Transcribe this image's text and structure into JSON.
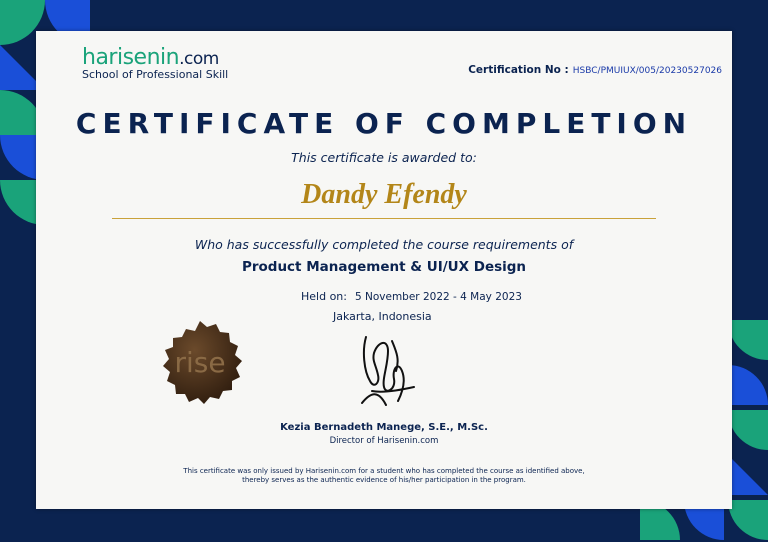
{
  "logo": {
    "name": "harisenin",
    "suffix": ".com",
    "tagline": "School of Professional Skill"
  },
  "certification": {
    "label": "Certification No :",
    "number": "HSBC/PMUIUX/005/20230527026"
  },
  "title": "CERTIFICATE OF COMPLETION",
  "awarded_text": "This certificate is awarded to:",
  "recipient": "Dandy Efendy",
  "completion_text": "Who has successfully completed the course requirements of",
  "course": "Product Management & UI/UX Design",
  "held": {
    "label": "Held on:",
    "dates": "5 November 2022 - 4 May 2023"
  },
  "location": "Jakarta, Indonesia",
  "seal": {
    "text": "rise"
  },
  "signer": {
    "name": "Kezia Bernadeth Manege, S.E., M.Sc.",
    "role": "Director of Harisenin.com"
  },
  "footnote": [
    "This certificate was only issued by Harisenin.com for a student who has completed the course as identified above,",
    "thereby serves as the authentic evidence of his/her participation in the program."
  ],
  "colors": {
    "navy": "#0b2350",
    "green": "#1aa37a",
    "blue": "#1a4fd8",
    "gold": "#b38619"
  }
}
